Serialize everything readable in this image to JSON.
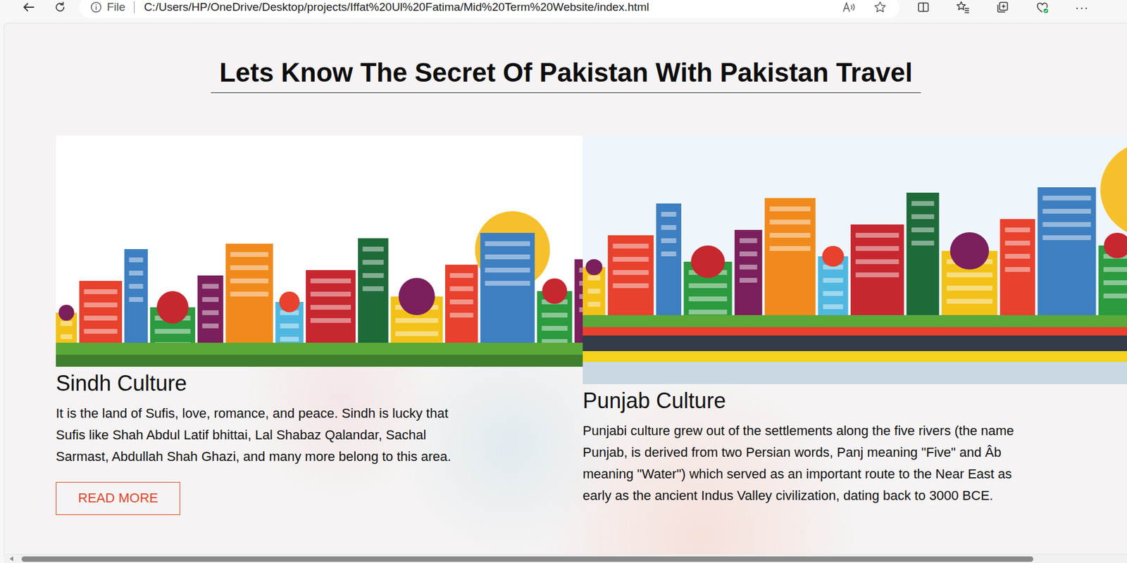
{
  "browser": {
    "address_prefix": "File",
    "url": "C:/Users/HP/OneDrive/Desktop/projects/Iffat%20Ul%20Fatima/Mid%20Term%20Website/index.html",
    "favorite": false,
    "menu": "···"
  },
  "page": {
    "heading": "Lets Know The Secret Of Pakistan With Pakistan Travel",
    "cards": [
      {
        "title": "Sindh Culture",
        "text": "It is the land of Sufis, love, romance, and peace. Sindh is lucky that Sufis like Shah Abdul Latif bhittai, Lal Shabaz Qalandar, Sachal Sarmast, Abdullah Shah Ghazi, and many more belong to this area.",
        "button": "READ MORE"
      },
      {
        "title": "Punjab Culture",
        "text": "Punjabi culture grew out of the settlements along the five rivers (the name Punjab, is derived from two Persian words, Panj meaning \"Five\" and Âb meaning \"Water\") which served as an important route to the Near East as early as the ancient Indus Valley civilization, dating back to 3000 BCE."
      }
    ]
  },
  "scrollbar": {
    "level": 0.92
  }
}
